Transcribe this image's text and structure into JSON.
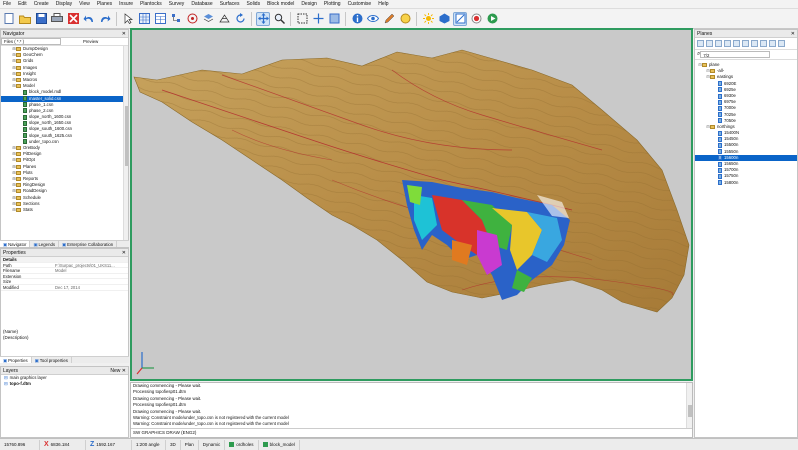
{
  "menu": [
    "File",
    "Edit",
    "Create",
    "Display",
    "View",
    "Planes",
    "Insure",
    "Plantocks",
    "Survey",
    "Database",
    "Surfaces",
    "Solids",
    "Block model",
    "Design",
    "Plotting",
    "Customise",
    "Help"
  ],
  "toolbar_icons": [
    "new-icon",
    "open-icon",
    "save-icon",
    "print-icon",
    "close-red-icon",
    "undo-icon",
    "redo-icon",
    "select-icon",
    "zoom-icon",
    "pan-icon",
    "grid-icon",
    "table-icon",
    "tree-icon",
    "target-icon",
    "layers-icon",
    "wireframe-icon",
    "rotate-icon",
    "selection-box-icon",
    "shading-icon",
    "crosshair-icon",
    "info-icon",
    "eye-icon",
    "pen-icon",
    "color-icon",
    "light-icon",
    "sphere-icon",
    "vector-icon",
    "record-icon",
    "play-icon"
  ],
  "navigator": {
    "title": "Navigator",
    "filter": "Files ( *.* )",
    "preview_label": "Preview",
    "items": [
      {
        "label": "DumpDesign",
        "type": "folder",
        "level": 1
      },
      {
        "label": "GeoChem",
        "type": "folder",
        "level": 1
      },
      {
        "label": "Grids",
        "type": "folder",
        "level": 1
      },
      {
        "label": "Images",
        "type": "folder",
        "level": 1
      },
      {
        "label": "Insight",
        "type": "folder",
        "level": 1
      },
      {
        "label": "Macros",
        "type": "folder",
        "level": 1
      },
      {
        "label": "Model",
        "type": "folder",
        "level": 1
      },
      {
        "label": "block_model.mdl",
        "type": "file",
        "level": 2
      },
      {
        "label": "master_solid.csn",
        "type": "file",
        "level": 2,
        "selected": true
      },
      {
        "label": "phase_1.csn",
        "type": "file",
        "level": 2
      },
      {
        "label": "phase_2.csn",
        "type": "file",
        "level": 2
      },
      {
        "label": "slope_north_1600.csn",
        "type": "file",
        "level": 2
      },
      {
        "label": "slope_north_1650.csn",
        "type": "file",
        "level": 2
      },
      {
        "label": "slope_south_1600.csn",
        "type": "file",
        "level": 2
      },
      {
        "label": "slope_south_1625.csn",
        "type": "file",
        "level": 2
      },
      {
        "label": "under_topo.csn",
        "type": "file",
        "level": 2
      },
      {
        "label": "OreBody",
        "type": "folder",
        "level": 1
      },
      {
        "label": "PitDesign",
        "type": "folder",
        "level": 1
      },
      {
        "label": "PitOpt",
        "type": "folder",
        "level": 1
      },
      {
        "label": "Planes",
        "type": "folder",
        "level": 1
      },
      {
        "label": "Plots",
        "type": "folder",
        "level": 1
      },
      {
        "label": "Reports",
        "type": "folder",
        "level": 1
      },
      {
        "label": "RingDesign",
        "type": "folder",
        "level": 1
      },
      {
        "label": "RoadDesign",
        "type": "folder",
        "level": 1
      },
      {
        "label": "Schedule",
        "type": "folder",
        "level": 1
      },
      {
        "label": "Sections",
        "type": "folder",
        "level": 1
      },
      {
        "label": "Stats",
        "type": "folder",
        "level": 1
      }
    ],
    "tabs": [
      "Navigator",
      "Legends",
      "Enterprise Collaboration"
    ]
  },
  "properties": {
    "title": "Properties",
    "section": "Details",
    "rows": [
      {
        "k": "Path",
        "v": "F:\\Surpac_projects\\01_UKS11..."
      },
      {
        "k": "Filename",
        "v": "Model"
      },
      {
        "k": "Extension",
        "v": ""
      },
      {
        "k": "Size",
        "v": ""
      },
      {
        "k": "Modified",
        "v": "Dec 17, 2014"
      }
    ],
    "name_label": "(Name)",
    "desc_label": "(Description)",
    "tabs": [
      "Properties",
      "Tool properties"
    ]
  },
  "layers": {
    "title": "Layers",
    "new_label": "New",
    "items": [
      {
        "label": "main graphics layer",
        "bold": false
      },
      {
        "label": "topo-f.dtm",
        "bold": true
      }
    ]
  },
  "planes": {
    "title": "Planes",
    "search_value": "7/2",
    "tree": [
      {
        "label": "plane",
        "level": 0
      },
      {
        "label": "-all-",
        "level": 1
      },
      {
        "label": "eastings",
        "level": 1
      },
      {
        "label": "6920E",
        "level": 2
      },
      {
        "label": "6925e",
        "level": 2
      },
      {
        "label": "6930e",
        "level": 2
      },
      {
        "label": "6975e",
        "level": 2
      },
      {
        "label": "7000e",
        "level": 2
      },
      {
        "label": "7025e",
        "level": 2
      },
      {
        "label": "7050e",
        "level": 2
      },
      {
        "label": "northings",
        "level": 1
      },
      {
        "label": "15400N",
        "level": 2
      },
      {
        "label": "15450n",
        "level": 2
      },
      {
        "label": "15500n",
        "level": 2
      },
      {
        "label": "15550n",
        "level": 2
      },
      {
        "label": "15600n",
        "level": 2,
        "selected": true
      },
      {
        "label": "15650n",
        "level": 2
      },
      {
        "label": "15700n",
        "level": 2
      },
      {
        "label": "15750n",
        "level": 2
      },
      {
        "label": "15800n",
        "level": 2
      }
    ]
  },
  "console": {
    "lines": [
      "Drawing commencing - Please wait.",
      "Processing topofiesp01.dtm",
      "Drawing commencing - Please wait.",
      "Processing topofiesp01.dtm",
      "Drawing commencing - Please wait.",
      "Warning: Constraint mode/under_topo.csn is not registered with the current model",
      "Warning: Constraint mode/under_topo.csn is not registered with the current model"
    ],
    "command": "SW GRAPHICS DRAW (ENG2)"
  },
  "status": {
    "y": "15760.896",
    "x": "6836.184",
    "z": "1592.167",
    "zoom": "1:200 angle",
    "mode": "3D",
    "view": "Plan",
    "dynamic": "Dynamic",
    "layer": "ordholes",
    "model": "block_model"
  }
}
